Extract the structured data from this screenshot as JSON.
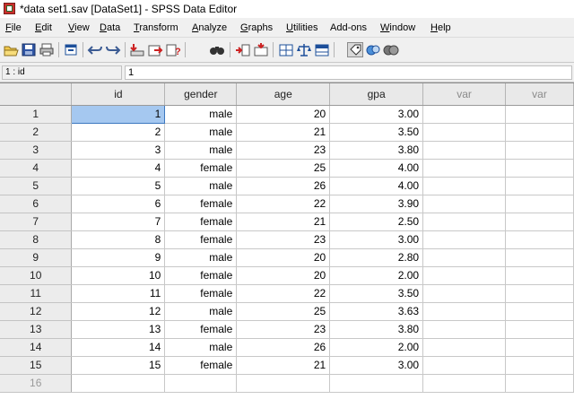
{
  "window": {
    "title": "*data set1.sav [DataSet1] - SPSS Data Editor"
  },
  "menu": [
    {
      "label": "File",
      "mn": "F",
      "rest": "ile"
    },
    {
      "label": "Edit",
      "mn": "E",
      "rest": "dit"
    },
    {
      "label": "View",
      "mn": "V",
      "rest": "iew"
    },
    {
      "label": "Data",
      "mn": "D",
      "rest": "ata"
    },
    {
      "label": "Transform",
      "mn": "T",
      "rest": "ransform"
    },
    {
      "label": "Analyze",
      "mn": "A",
      "rest": "nalyze"
    },
    {
      "label": "Graphs",
      "mn": "G",
      "rest": "raphs"
    },
    {
      "label": "Utilities",
      "mn": "U",
      "rest": "tilities"
    },
    {
      "label": "Add-ons",
      "mn": "",
      "rest": "Add-ons"
    },
    {
      "label": "Window",
      "mn": "W",
      "rest": "indow"
    },
    {
      "label": "Help",
      "mn": "H",
      "rest": "elp"
    }
  ],
  "toolbar": {
    "icons": [
      "open-folder-icon",
      "save-icon",
      "print-icon",
      "dialog-recall-icon",
      "undo-icon",
      "redo-icon",
      "goto-case-icon",
      "goto-variable-icon",
      "variables-info-icon",
      "find-icon",
      "insert-case-icon",
      "insert-variable-icon",
      "split-file-icon",
      "weight-cases-icon",
      "select-cases-icon",
      "value-labels-icon",
      "use-sets-icon",
      "show-all-variables-icon"
    ]
  },
  "cellbar": {
    "reference": "1 : id",
    "value": "1"
  },
  "grid": {
    "columns": [
      "id",
      "gender",
      "age",
      "gpa",
      "var",
      "var"
    ],
    "rows": [
      {
        "n": "1",
        "id": "1",
        "gender": "male",
        "age": "20",
        "gpa": "3.00"
      },
      {
        "n": "2",
        "id": "2",
        "gender": "male",
        "age": "21",
        "gpa": "3.50"
      },
      {
        "n": "3",
        "id": "3",
        "gender": "male",
        "age": "23",
        "gpa": "3.80"
      },
      {
        "n": "4",
        "id": "4",
        "gender": "female",
        "age": "25",
        "gpa": "4.00"
      },
      {
        "n": "5",
        "id": "5",
        "gender": "male",
        "age": "26",
        "gpa": "4.00"
      },
      {
        "n": "6",
        "id": "6",
        "gender": "female",
        "age": "22",
        "gpa": "3.90"
      },
      {
        "n": "7",
        "id": "7",
        "gender": "female",
        "age": "21",
        "gpa": "2.50"
      },
      {
        "n": "8",
        "id": "8",
        "gender": "female",
        "age": "23",
        "gpa": "3.00"
      },
      {
        "n": "9",
        "id": "9",
        "gender": "male",
        "age": "20",
        "gpa": "2.80"
      },
      {
        "n": "10",
        "id": "10",
        "gender": "female",
        "age": "20",
        "gpa": "2.00"
      },
      {
        "n": "11",
        "id": "11",
        "gender": "female",
        "age": "22",
        "gpa": "3.50"
      },
      {
        "n": "12",
        "id": "12",
        "gender": "male",
        "age": "25",
        "gpa": "3.63"
      },
      {
        "n": "13",
        "id": "13",
        "gender": "female",
        "age": "23",
        "gpa": "3.80"
      },
      {
        "n": "14",
        "id": "14",
        "gender": "male",
        "age": "26",
        "gpa": "2.00"
      },
      {
        "n": "15",
        "id": "15",
        "gender": "female",
        "age": "21",
        "gpa": "3.00"
      },
      {
        "n": "16",
        "id": "",
        "gender": "",
        "age": "",
        "gpa": ""
      }
    ]
  },
  "colors": {
    "selected_cell": "#a5c8f0",
    "header_bg": "#e9e9e9",
    "chrome": "#f0f0f0"
  }
}
